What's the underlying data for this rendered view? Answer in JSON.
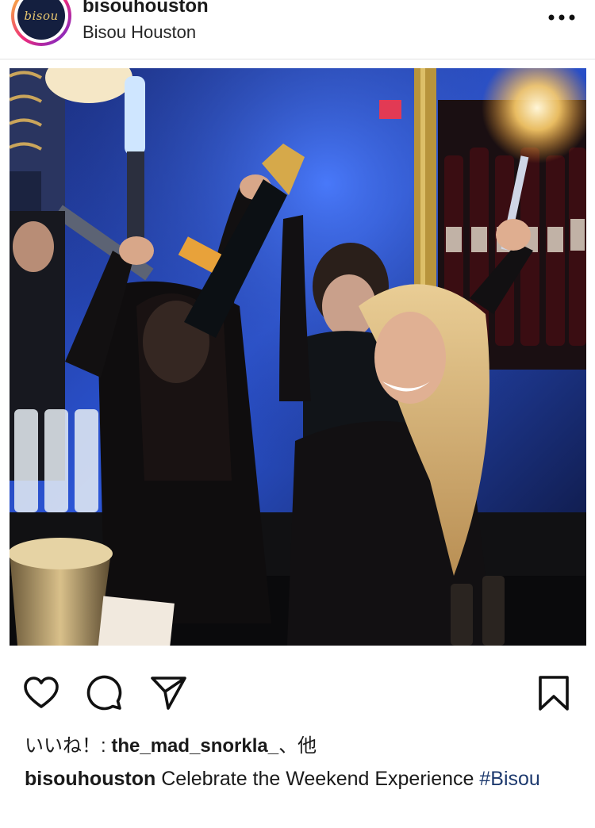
{
  "header": {
    "username": "bisouhouston",
    "location": "Bisou Houston",
    "avatar_logo_text": "bisou",
    "more_icon": "more-horizontal-icon"
  },
  "photo": {
    "subject": "Two women celebrating at a nightclub bar holding a champagne bottle and a sparkler"
  },
  "actions": {
    "like_icon": "heart-icon",
    "comment_icon": "comment-icon",
    "share_icon": "send-icon",
    "save_icon": "bookmark-icon"
  },
  "likes": {
    "prefix": "いいね！: ",
    "liker": "the_mad_snorkla_",
    "suffix": "、他"
  },
  "caption": {
    "username": "bisouhouston",
    "text": " Celebrate the Weekend Experience ",
    "hashtag": "#Bisou"
  },
  "colors": {
    "text": "#111111",
    "hashtag": "#1e3a6e",
    "divider": "#e3e3e3",
    "avatar_bg": "#141f3f",
    "avatar_gold": "#e8c770"
  }
}
